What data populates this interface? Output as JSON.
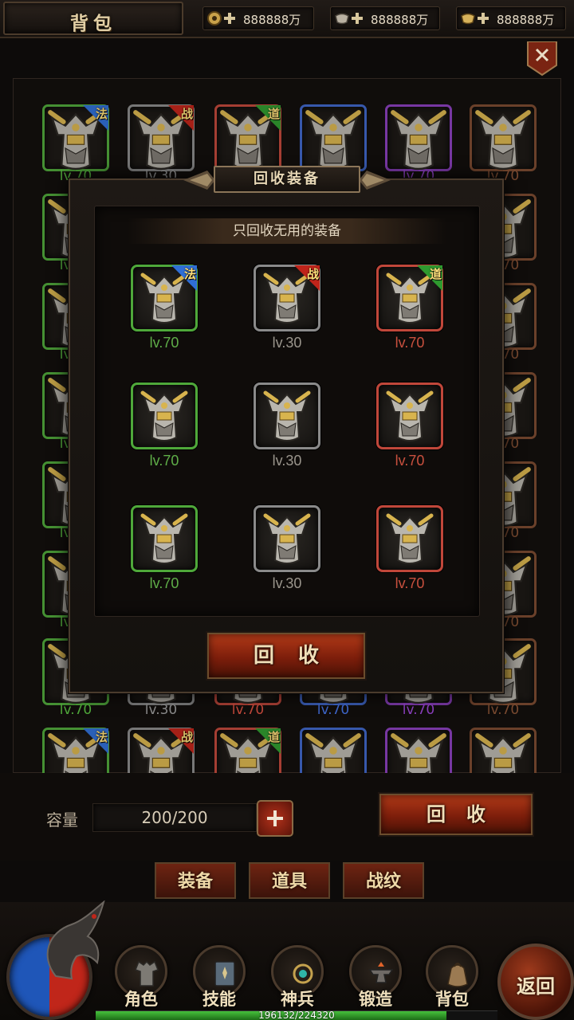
{
  "header": {
    "title": "背包",
    "currencies": [
      {
        "icon": "coin-plus-icon",
        "value": "888888万"
      },
      {
        "icon": "ingot-plus-icon",
        "value": "888888万"
      },
      {
        "icon": "gold-ingot-plus-icon",
        "value": "888888万"
      }
    ],
    "close_icon": "close-icon"
  },
  "bag": {
    "columns": 6,
    "visible_levels_row": [
      "lv.70",
      "lv.30",
      "lv.70",
      "lv.70",
      "lv.70",
      "lv.70"
    ],
    "class_badges": [
      "法",
      "战",
      "道"
    ],
    "capacity_label": "容量",
    "capacity_value": "200/200",
    "recycle_label": "回收"
  },
  "tabs": [
    {
      "label": "装备"
    },
    {
      "label": "道具"
    },
    {
      "label": "战纹"
    }
  ],
  "nav": {
    "items": [
      {
        "label": "角色",
        "icon": "armor-icon"
      },
      {
        "label": "技能",
        "icon": "skill-book-icon"
      },
      {
        "label": "神兵",
        "icon": "divine-weapon-icon"
      },
      {
        "label": "锻造",
        "icon": "anvil-icon"
      },
      {
        "label": "背包",
        "icon": "bag-icon"
      }
    ],
    "return_label": "返回",
    "exp_text": "196132/224320",
    "exp_fraction": 0.874
  },
  "modal": {
    "title": "回收装备",
    "subtitle": "只回收无用的装备",
    "items": [
      {
        "level": "lv.70",
        "badge": "法",
        "rarity": "green"
      },
      {
        "level": "lv.30",
        "badge": "战",
        "rarity": "gray"
      },
      {
        "level": "lv.70",
        "badge": "道",
        "rarity": "red"
      },
      {
        "level": "lv.70",
        "badge": "",
        "rarity": "green"
      },
      {
        "level": "lv.30",
        "badge": "",
        "rarity": "gray"
      },
      {
        "level": "lv.70",
        "badge": "",
        "rarity": "red"
      },
      {
        "level": "lv.70",
        "badge": "",
        "rarity": "green"
      },
      {
        "level": "lv.30",
        "badge": "",
        "rarity": "gray"
      },
      {
        "level": "lv.70",
        "badge": "",
        "rarity": "red"
      }
    ],
    "recycle_label": "回收"
  },
  "colors": {
    "green": "#4fa83a",
    "gray": "#8a8a8a",
    "red": "#c0473a",
    "blue": "#3e66c9",
    "purple": "#8a3fbd",
    "brown": "#7a4a30",
    "badge_blue": "#2f6fd6",
    "badge_red": "#c0241a",
    "badge_green": "#2f9a2f"
  }
}
